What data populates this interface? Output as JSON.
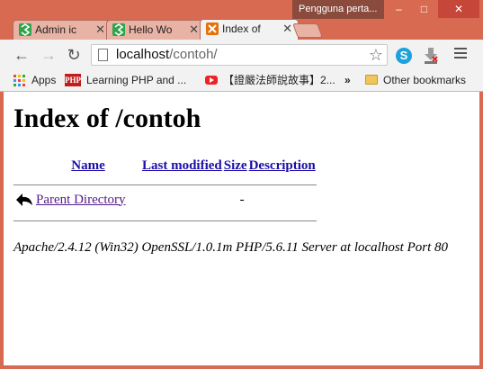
{
  "window": {
    "profile_name": "Pengguna perta...",
    "minimize_glyph": "–",
    "maximize_glyph": "□",
    "close_glyph": "✕"
  },
  "tabs": [
    {
      "label": "Admin ic",
      "icon": "green-favicon",
      "active": false,
      "close": "✕"
    },
    {
      "label": "Hello Wo",
      "icon": "green-favicon",
      "active": false,
      "close": "✕"
    },
    {
      "label": "Index of",
      "icon": "xampp-favicon",
      "active": true,
      "close": "✕"
    }
  ],
  "toolbar": {
    "back_glyph": "←",
    "forward_glyph": "→",
    "reload_glyph": "↻",
    "url_host": "localhost",
    "url_path": "/contoh/",
    "star_glyph": "☆",
    "skype_letter": "S"
  },
  "bookmarks": {
    "apps": "Apps",
    "php": "Learning PHP and ...",
    "php_badge": "PHP",
    "youtube": "【證嚴法師說故事】2...",
    "more": "»",
    "other": "Other bookmarks"
  },
  "page": {
    "title": "Index of /contoh",
    "columns": {
      "name": "Name",
      "modified": "Last modified",
      "size": "Size",
      "description": "Description"
    },
    "rows": [
      {
        "name": "Parent Directory",
        "modified": "",
        "size": "-",
        "description": ""
      }
    ],
    "address": "Apache/2.4.12 (Win32) OpenSSL/1.0.1m PHP/5.6.11 Server at localhost Port 80"
  },
  "colors": {
    "frame": "#d86a52",
    "link": "#1a0dab",
    "visited_link": "#551a8b"
  }
}
